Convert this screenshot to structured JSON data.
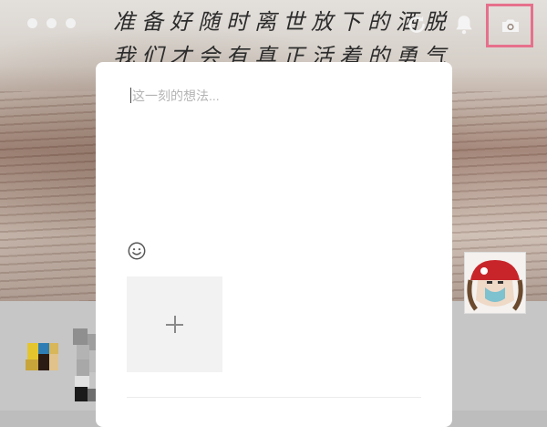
{
  "cover": {
    "line1": "准备好随时离世放下的洒脱",
    "line2": "我们才会有真正活着的勇气"
  },
  "toolbar": {
    "icons": [
      "window-dots",
      "refresh-icon",
      "bell-icon",
      "camera-icon"
    ],
    "highlight_color": "#e6708c"
  },
  "composer": {
    "placeholder": "这一刻的想法...",
    "emoji_icon": "emoji-icon",
    "add_icon": "plus-icon"
  }
}
